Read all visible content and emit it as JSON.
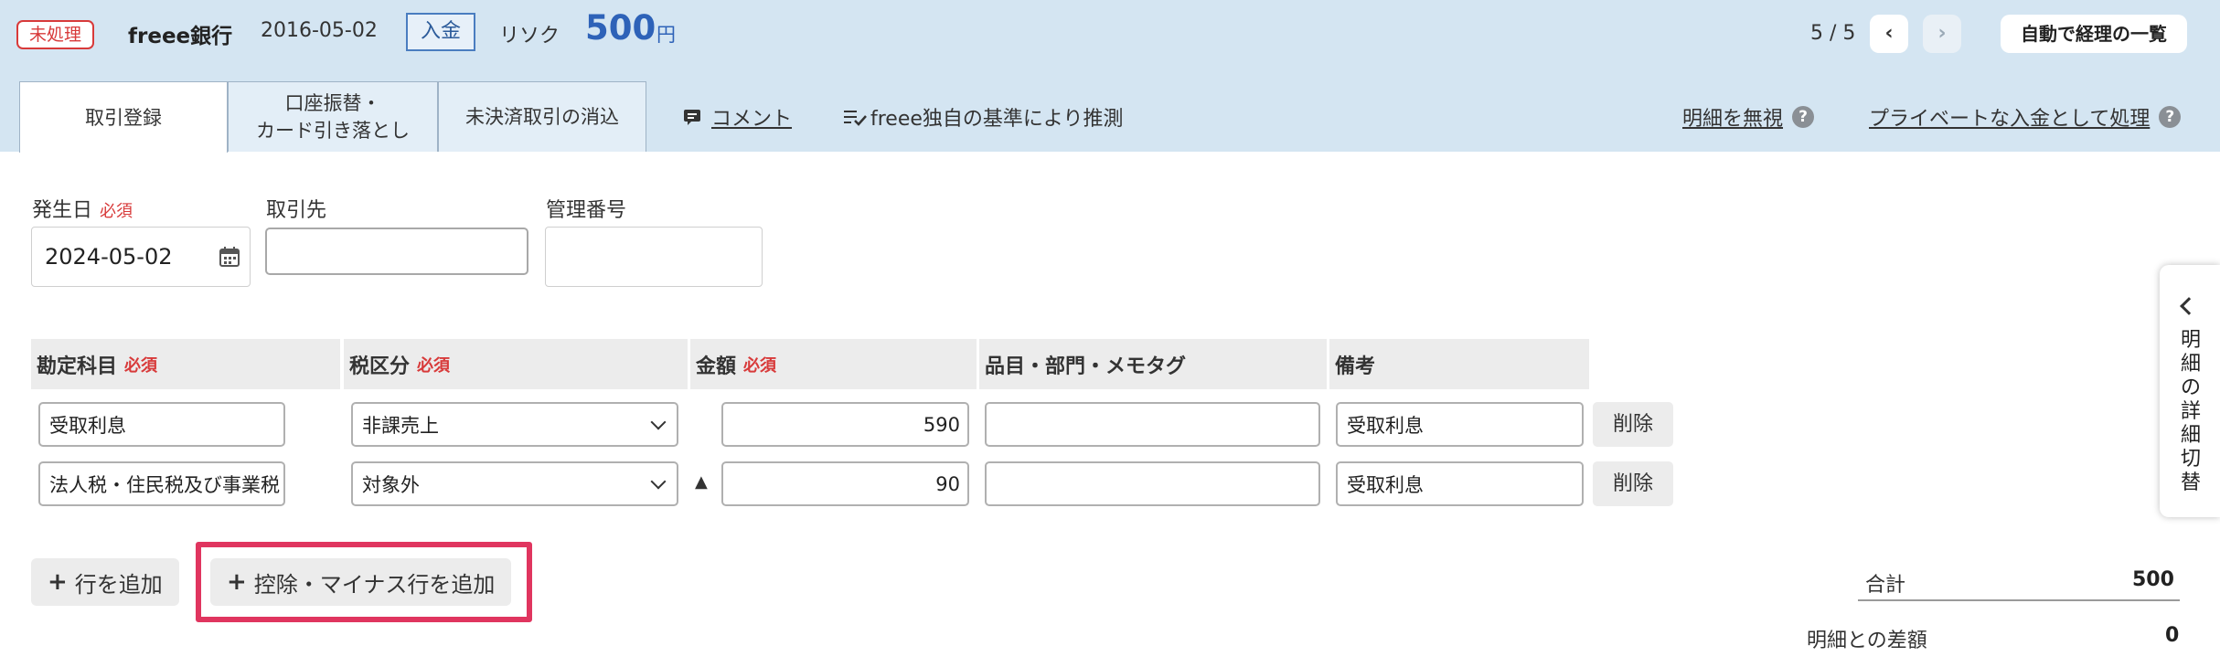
{
  "header": {
    "status_badge": "未処理",
    "bank_name": "freee銀行",
    "date": "2016-05-02",
    "type_badge": "入金",
    "payee": "リソク",
    "amount": "500",
    "amount_unit": "円",
    "pager": "5 / 5",
    "prev_icon": "‹",
    "next_icon": "›",
    "list_button": "自動で経理の一覧"
  },
  "tabs": [
    {
      "label": "取引登録"
    },
    {
      "label": "口座振替・\nカード引き落とし"
    },
    {
      "label": "未決済取引の消込"
    }
  ],
  "links": {
    "comment": "コメント",
    "inferred": "freee独自の基準により推測",
    "ignore": "明細を無視",
    "private": "プライベートな入金として処理",
    "help_glyph": "?"
  },
  "form": {
    "date_label": "発生日",
    "required": "必須",
    "date_value": "2024-05-02",
    "partner_label": "取引先",
    "partner_value": "",
    "mgmt_label": "管理番号",
    "mgmt_value": ""
  },
  "table": {
    "headers": [
      "勘定科目",
      "税区分",
      "金額",
      "品目・部門・メモタグ",
      "備考"
    ],
    "rows": [
      {
        "account": "受取利息",
        "tax": "非課売上",
        "minus": "",
        "amount": "590",
        "tags": "",
        "note": "受取利息",
        "delete": "削除"
      },
      {
        "account": "法人税・住民税及び事業税",
        "tax": "対象外",
        "minus": "▲",
        "amount": "90",
        "tags": "",
        "note": "受取利息",
        "delete": "削除"
      }
    ]
  },
  "bottom": {
    "add_row": "行を追加",
    "add_minus_row": "控除・マイナス行を追加",
    "plus": "+",
    "total_label": "合計",
    "total_value": "500",
    "diff_label": "明細との差額",
    "diff_value": "0"
  },
  "side_toggle": {
    "label": "明細の詳細切替"
  },
  "colors": {
    "header_bg": "#d4e5f2",
    "required": "#d83a3a",
    "amount": "#2e62b8",
    "highlight": "#e0355f"
  }
}
